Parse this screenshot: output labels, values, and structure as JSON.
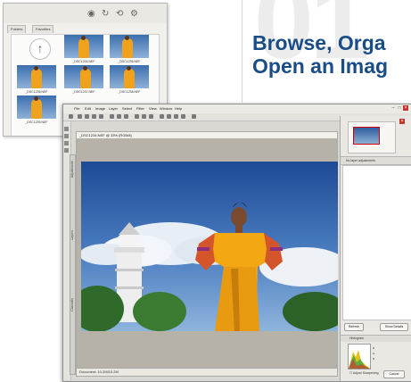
{
  "page": {
    "step_number": "01",
    "headline_line1": "Browse, Orga",
    "headline_line2": "Open an Imag"
  },
  "browser": {
    "tabs": [
      "Folders",
      "Favorites"
    ],
    "icons": [
      "camera-icon",
      "refresh-icon",
      "rotate-icon",
      "settings-icon"
    ],
    "thumbnails": [
      {
        "caption": "...",
        "is_folder": true
      },
      {
        "caption": "_DSC1234.NEF"
      },
      {
        "caption": "_DSC1235.NEF"
      },
      {
        "caption": "_DSC1236.NEF"
      },
      {
        "caption": "_DSC1237.NEF"
      },
      {
        "caption": "_DSC1238.NEF"
      },
      {
        "caption": "_DSC1239.NEF"
      }
    ]
  },
  "photoshop": {
    "menus": [
      "File",
      "Edit",
      "Image",
      "Layer",
      "Select",
      "Filter",
      "View",
      "Window",
      "Help"
    ],
    "document_title": "_DSC1234.NEF @ 33% (RGB/8)",
    "status_text": "Document: 10.2M/10.2M",
    "side_labels": [
      "Adjustments",
      "Layers",
      "Channels"
    ],
    "layers_panel_label": "No layer adjustments",
    "histogram_label": "Histogram",
    "buttons": {
      "refresh": "Refresh",
      "cancel": "Cancel",
      "show_details": "Show Details"
    },
    "checkbox_label": "Adjust Sharpening",
    "rows": [
      "R",
      "G",
      "B"
    ],
    "accent_color": "#c4362e"
  }
}
